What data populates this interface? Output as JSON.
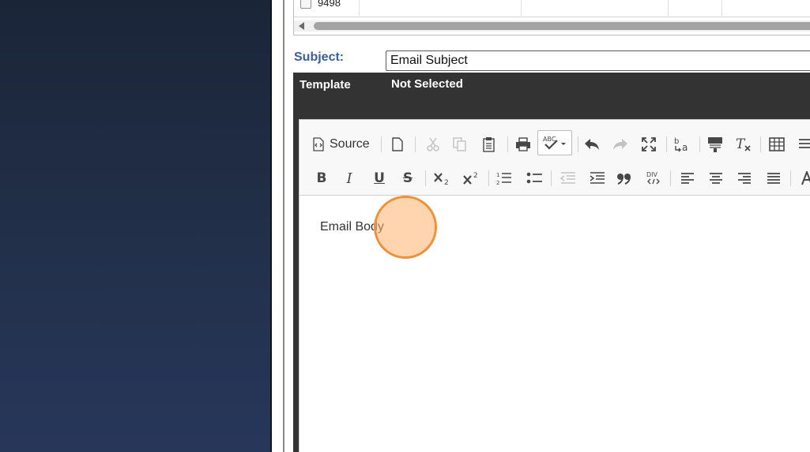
{
  "grid": {
    "row": {
      "id": "9498"
    }
  },
  "subject": {
    "label": "Subject:",
    "value": "Email Subject"
  },
  "template": {
    "label": "Template",
    "value": "Not Selected"
  },
  "editor": {
    "toolbar": {
      "source_label": "Source"
    },
    "body_text": "Email Body"
  },
  "colors": {
    "subject_label": "#3b5f99",
    "template_bar": "#333333",
    "click_indicator": "#f0913a"
  }
}
